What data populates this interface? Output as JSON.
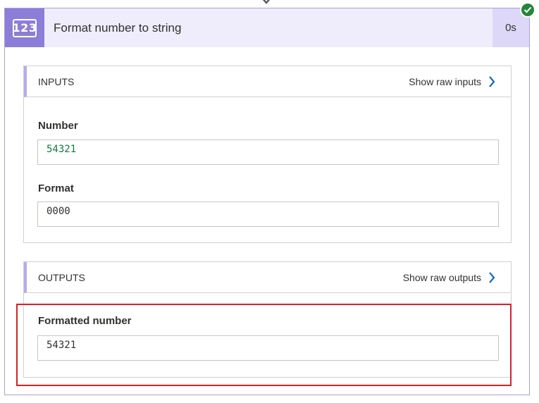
{
  "action": {
    "icon_text": "123",
    "title": "Format number to string",
    "duration": "0s",
    "status": "succeeded",
    "accent_color": "#8c7ed8",
    "success_color": "#25863a"
  },
  "inputs": {
    "section_title": "INPUTS",
    "raw_link": "Show raw inputs",
    "fields": [
      {
        "label": "Number",
        "value": "54321",
        "value_color": "#107c41"
      },
      {
        "label": "Format",
        "value": "0000",
        "value_color": "#323130"
      }
    ]
  },
  "outputs": {
    "section_title": "OUTPUTS",
    "raw_link": "Show raw outputs",
    "fields": [
      {
        "label": "Formatted number",
        "value": "54321",
        "value_color": "#323130"
      }
    ]
  }
}
